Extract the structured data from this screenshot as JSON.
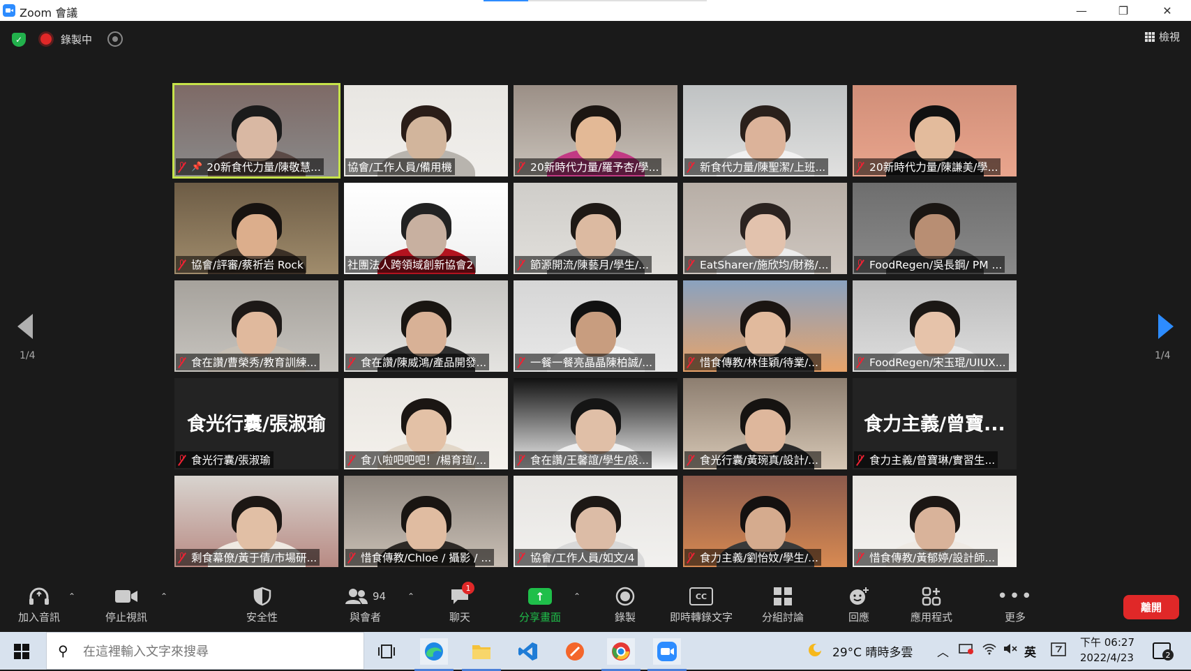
{
  "window": {
    "title": "Zoom 會議",
    "minimize_glyph": "—",
    "restore_glyph": "❐",
    "close_glyph": "✕"
  },
  "topbar": {
    "recording_label": "錄製中",
    "view_label": "檢視"
  },
  "pagination": {
    "left": "1/4",
    "right": "1/4"
  },
  "participants": [
    {
      "name": "20新食代力量/陳敬慧...",
      "active": true,
      "pinned": true
    },
    {
      "name": "協會/工作人員/備用機",
      "muted": false
    },
    {
      "name": "20新時代力量/羅予杏/學..."
    },
    {
      "name": "新食代力量/陳聖潔/上班..."
    },
    {
      "name": "20新時代力量/陳謙美/學..."
    },
    {
      "name": "協會/評審/蔡祈岩 Rock"
    },
    {
      "name": "社團法人跨領域創新協會2",
      "muted": false
    },
    {
      "name": "節源開流/陳藝月/學生/..."
    },
    {
      "name": "EatSharer/施欣均/財務/..."
    },
    {
      "name": "FoodRegen/吳長鋼/ PM ..."
    },
    {
      "name": "食在讚/曹榮秀/教育訓練..."
    },
    {
      "name": "食在讚/陳威鴻/產品開發..."
    },
    {
      "name": "一餐一餐亮晶晶陳柏誠/..."
    },
    {
      "name": "惜食傳教/林佳穎/待業/..."
    },
    {
      "name": "FoodRegen/宋玉琨/UIUX..."
    },
    {
      "name": "食光行囊/張淑瑜",
      "big_name": "食光行囊/張淑瑜"
    },
    {
      "name": "食八啦吧吧吧！/楊育瑄/..."
    },
    {
      "name": "食在讚/王馨誼/學生/設..."
    },
    {
      "name": "食光行囊/黃琬真/設計/..."
    },
    {
      "name": "食力主義/曾寶琳/實習生...",
      "big_name": "食力主義/曾寶..."
    },
    {
      "name": "剩食幕僚/黃于倩/市場研..."
    },
    {
      "name": "惜食傳教/Chloe / 攝影 / ..."
    },
    {
      "name": "協會/工作人員/如文/4"
    },
    {
      "name": "食力主義/劉怡妏/學生/..."
    },
    {
      "name": "惜食傳教/黃郁婷/設計師..."
    }
  ],
  "toolbar": {
    "audio": "加入音訊",
    "video": "停止視訊",
    "security": "安全性",
    "participants": "與會者",
    "participant_count": "94",
    "chat": "聊天",
    "chat_badge": "1",
    "share": "分享畫面",
    "record": "錄製",
    "cc_icon": "CC",
    "captions": "即時轉錄文字",
    "breakout": "分組討論",
    "reactions": "回應",
    "apps": "應用程式",
    "more": "更多",
    "leave": "離開"
  },
  "taskbar": {
    "search_placeholder": "在這裡輸入文字來搜尋",
    "weather": "29°C 晴時多雲",
    "input_lang": "英",
    "time": "下午 06:27",
    "date": "2022/4/23",
    "notification_count": "2"
  },
  "colors": {
    "accent": "#2d8cff",
    "active_speaker": "#c6e34a",
    "share_green": "#1fbf4a",
    "leave_red": "#e02828"
  }
}
